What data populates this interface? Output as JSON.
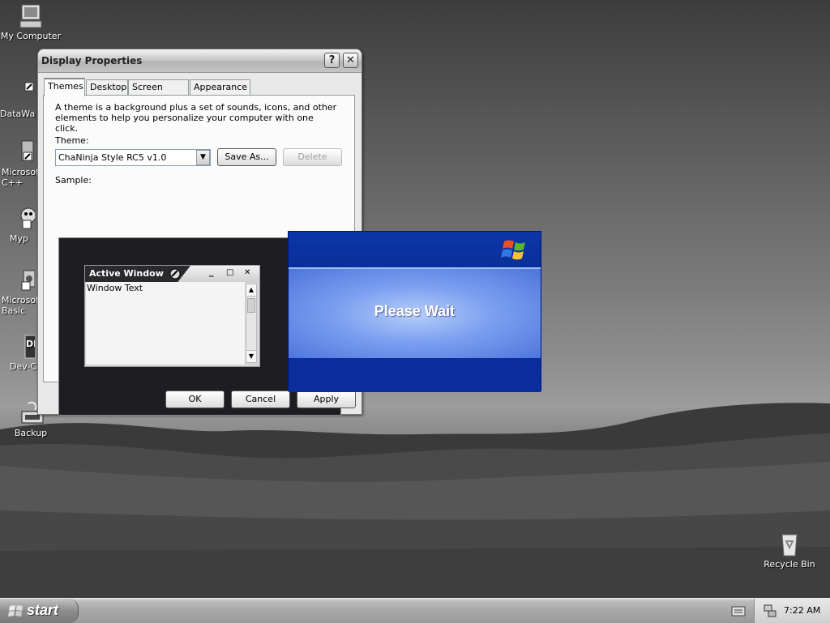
{
  "desktop": {
    "icons": [
      {
        "label": "My Computer",
        "icon": "my-computer-icon"
      },
      {
        "label": "DataWa",
        "icon": "shortcut-icon"
      },
      {
        "label": "Microsoft C++",
        "icon": "shortcut-icon"
      },
      {
        "label": "Myp",
        "icon": "shortcut-icon"
      },
      {
        "label": "Microsoft Basic",
        "icon": "shortcut-icon"
      },
      {
        "label": "Dev-C",
        "icon": "dev-cpp-icon"
      },
      {
        "label": "Backup",
        "icon": "backup-icon"
      },
      {
        "label": "Recycle Bin",
        "icon": "recycle-bin-icon"
      }
    ]
  },
  "display_properties": {
    "title": "Display Properties",
    "help_button": "?",
    "close_button": "✕",
    "tabs": [
      {
        "label": "Themes",
        "active": true
      },
      {
        "label": "Desktop",
        "active": false
      },
      {
        "label": "Screen Saver",
        "active": false
      },
      {
        "label": "Appearance",
        "active": false
      }
    ],
    "description": "A theme is a background plus a set of sounds, icons, and other elements to help you personalize your computer with one click.",
    "theme_label": "Theme:",
    "theme_value": "ChaNinja Style RC5 v1.0",
    "save_as_button": "Save As...",
    "delete_button": "Delete",
    "sample_label": "Sample:",
    "sample_window": {
      "title": "Active Window",
      "body_text": "Window Text",
      "minimize": "_",
      "maximize": "□",
      "close": "✕"
    },
    "ok_button": "OK",
    "cancel_button": "Cancel",
    "apply_button": "Apply"
  },
  "please_wait": {
    "message": "Please Wait",
    "logo": "windows-logo-icon"
  },
  "taskbar": {
    "start_label": "start",
    "clock": "7:22 AM",
    "tray_icons": [
      "keyboard-icon",
      "network-icon"
    ]
  },
  "colors": {
    "please_wait_blue": "#0a2e9c",
    "please_wait_highlight": "#b7cdfa"
  }
}
